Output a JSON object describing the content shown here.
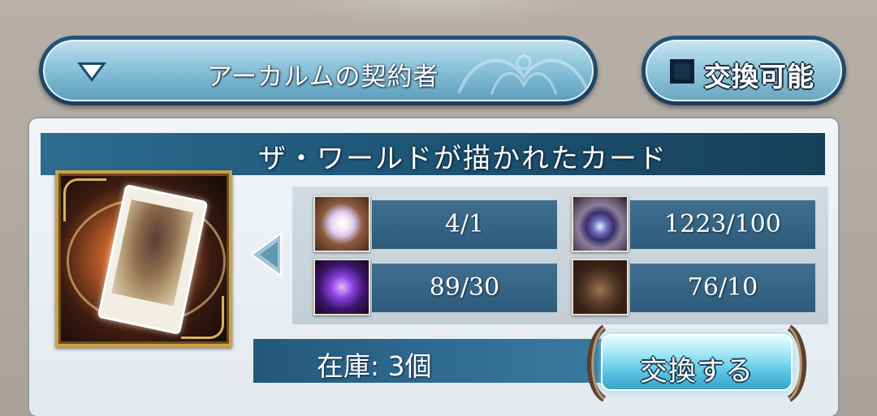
{
  "filter": {
    "selected_label": "アーカルムの契約者"
  },
  "toggle": {
    "label": "交換可能",
    "checked": false
  },
  "item": {
    "title": "ザ・ワールドが描かれたカード",
    "icon": "tarot-card-the-world",
    "stock_label": "在庫: 3個"
  },
  "materials": [
    {
      "icon": "crystal-icon",
      "count": "4/1"
    },
    {
      "icon": "eye-orb-icon",
      "count": "1223/100"
    },
    {
      "icon": "amethyst-icon",
      "count": "89/30"
    },
    {
      "icon": "relic-box-icon",
      "count": "76/10"
    }
  ],
  "actions": {
    "exchange_label": "交換する"
  },
  "colors": {
    "accent_blue": "#2f6a90",
    "panel_bg": "#eef2f5",
    "gold_frame": "#caa24a"
  }
}
